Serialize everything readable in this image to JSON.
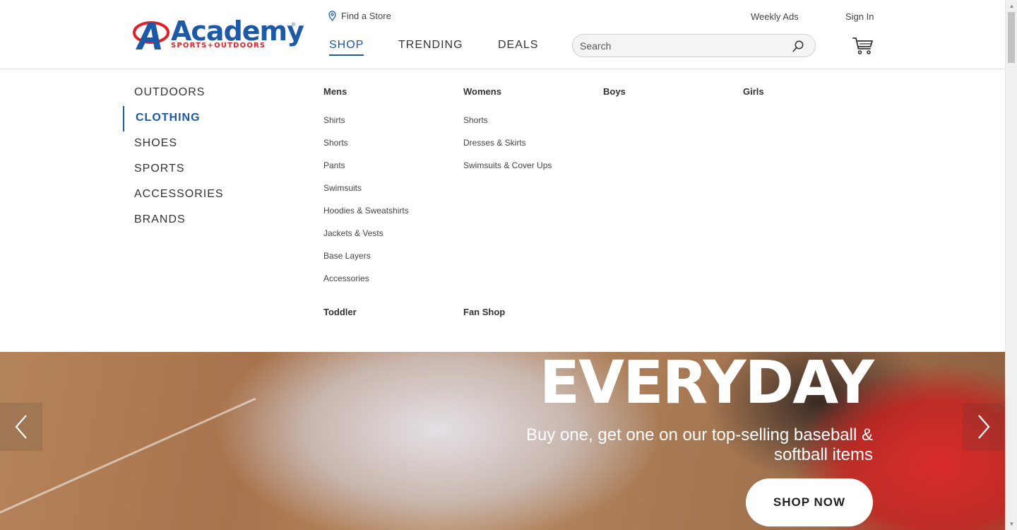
{
  "header": {
    "logo_word": "Academy",
    "logo_sub": "SPORTS+OUTDOORS",
    "logo_reg": "®",
    "find_store": "Find a Store",
    "weekly_ads": "Weekly Ads",
    "sign_in": "Sign In",
    "nav": {
      "shop": "SHOP",
      "trending": "TRENDING",
      "deals": "DEALS"
    },
    "search_placeholder": "Search"
  },
  "categories": [
    "OUTDOORS",
    "CLOTHING",
    "SHOES",
    "SPORTS",
    "ACCESSORIES",
    "BRANDS"
  ],
  "active_category": "CLOTHING",
  "menu": {
    "mens": {
      "heading": "Mens",
      "links": [
        "Shirts",
        "Shorts",
        "Pants",
        "Swimsuits",
        "Hoodies & Sweatshirts",
        "Jackets & Vests",
        "Base Layers",
        "Accessories"
      ]
    },
    "womens": {
      "heading": "Womens",
      "links": [
        "Shorts",
        "Dresses & Skirts",
        "Swimsuits & Cover Ups"
      ]
    },
    "boys": {
      "heading": "Boys"
    },
    "girls": {
      "heading": "Girls"
    },
    "toddler": {
      "heading": "Toddler"
    },
    "fan_shop": {
      "heading": "Fan Shop"
    }
  },
  "hero": {
    "title": "EVERYDAY",
    "subtitle": "Buy one, get one on our top-selling baseball & softball items",
    "cta": "SHOP NOW"
  },
  "colors": {
    "brand_blue": "#1c5aa8",
    "brand_red": "#e21f26"
  }
}
